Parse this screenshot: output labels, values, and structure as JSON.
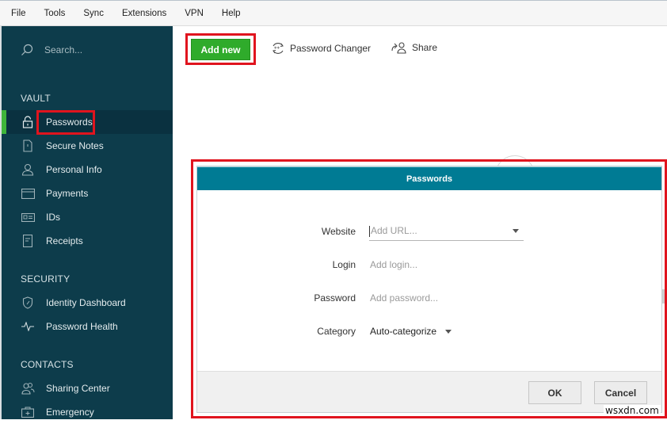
{
  "menubar": {
    "items": [
      "File",
      "Tools",
      "Sync",
      "Extensions",
      "VPN",
      "Help"
    ]
  },
  "sidebar": {
    "search_placeholder": "Search...",
    "sections": {
      "vault": "VAULT",
      "security": "SECURITY",
      "contacts": "CONTACTS"
    },
    "vault_items": [
      {
        "label": "Passwords",
        "icon": "lock-icon",
        "active": true
      },
      {
        "label": "Secure Notes",
        "icon": "note-icon"
      },
      {
        "label": "Personal Info",
        "icon": "person-icon"
      },
      {
        "label": "Payments",
        "icon": "card-icon"
      },
      {
        "label": "IDs",
        "icon": "id-card-icon"
      },
      {
        "label": "Receipts",
        "icon": "receipt-icon"
      }
    ],
    "security_items": [
      {
        "label": "Identity Dashboard",
        "icon": "shield-icon"
      },
      {
        "label": "Password Health",
        "icon": "pulse-icon"
      }
    ],
    "contacts_items": [
      {
        "label": "Sharing Center",
        "icon": "people-icon"
      },
      {
        "label": "Emergency",
        "icon": "first-aid-icon"
      }
    ]
  },
  "toolbar": {
    "add_new": "Add new",
    "password_changer": "Password Changer",
    "share": "Share"
  },
  "dialog": {
    "title": "Passwords",
    "fields": {
      "website_label": "Website",
      "website_placeholder": "Add URL...",
      "login_label": "Login",
      "login_placeholder": "Add login...",
      "password_label": "Password",
      "password_placeholder": "Add password...",
      "category_label": "Category",
      "category_value": "Auto-categorize"
    },
    "ok": "OK",
    "cancel": "Cancel"
  },
  "colors": {
    "sidebar_bg": "#0d3c4b",
    "accent_green": "#2fab2b",
    "dialog_header": "#007b94",
    "highlight_red": "#e0141e"
  },
  "watermark": "wsxdn.com"
}
